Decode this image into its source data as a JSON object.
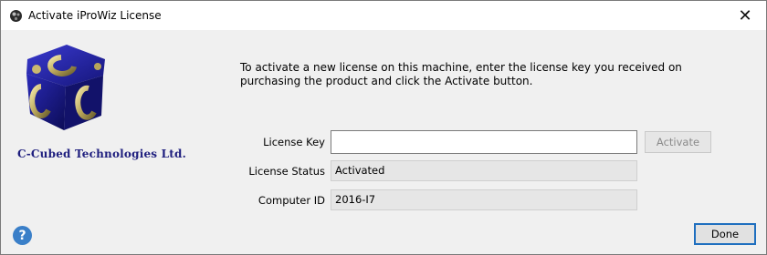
{
  "window": {
    "title": "Activate iProWiz License",
    "close_glyph": "✕"
  },
  "company": {
    "name": "C-Cubed Technologies Ltd."
  },
  "instructions": "To activate a new license on this machine, enter the license key you received on purchasing the product and click the Activate button.",
  "form": {
    "license_key_label": "License Key",
    "license_key_value": "",
    "license_status_label": "License Status",
    "license_status_value": "Activated",
    "computer_id_label": "Computer ID",
    "computer_id_value": "2016-I7"
  },
  "buttons": {
    "activate": "Activate",
    "done": "Done",
    "help": "?"
  },
  "colors": {
    "accent": "#1f6fbf",
    "brand": "#1e1e7e",
    "help": "#3a7fc8"
  }
}
